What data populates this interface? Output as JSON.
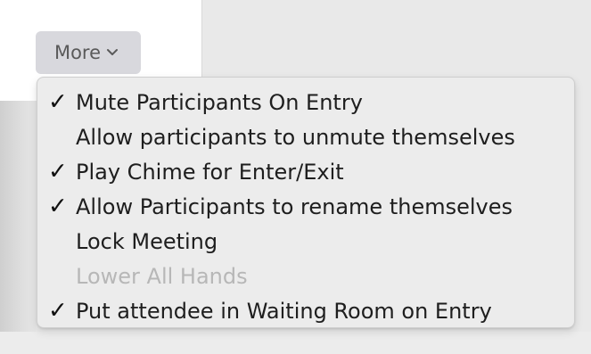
{
  "toolbar": {
    "more_label": "More"
  },
  "menu": {
    "items": [
      {
        "label": "Mute Participants On Entry",
        "checked": "✓",
        "enabled": true
      },
      {
        "label": "Allow participants to unmute themselves",
        "checked": "",
        "enabled": true
      },
      {
        "label": "Play Chime for Enter/Exit",
        "checked": "✓",
        "enabled": true
      },
      {
        "label": "Allow Participants to rename themselves",
        "checked": "✓",
        "enabled": true
      },
      {
        "label": "Lock Meeting",
        "checked": "",
        "enabled": true
      },
      {
        "label": "Lower All Hands",
        "checked": "",
        "enabled": false
      },
      {
        "label": "Put attendee in Waiting Room on Entry",
        "checked": "✓",
        "enabled": true
      }
    ]
  },
  "colors": {
    "menu_background": "#ececec",
    "button_background": "#d8d8dd",
    "disabled_text": "#b7b7b7"
  }
}
